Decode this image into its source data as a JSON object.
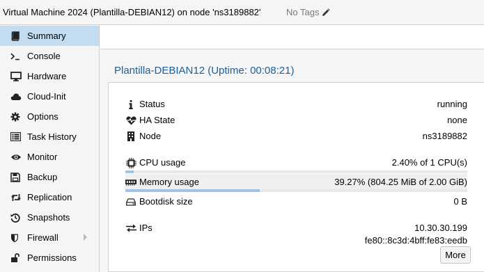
{
  "header": {
    "vm_title": "Virtual Machine 2024 (Plantilla-DEBIAN12) on node 'ns3189882'",
    "tags_label": "No Tags"
  },
  "sidebar": {
    "items": [
      {
        "label": "Summary",
        "icon": "book-icon",
        "active": true
      },
      {
        "label": "Console",
        "icon": "terminal-icon"
      },
      {
        "label": "Hardware",
        "icon": "monitor-icon"
      },
      {
        "label": "Cloud-Init",
        "icon": "cloud-icon"
      },
      {
        "label": "Options",
        "icon": "gear-icon"
      },
      {
        "label": "Task History",
        "icon": "list-icon"
      },
      {
        "label": "Monitor",
        "icon": "eye-icon"
      },
      {
        "label": "Backup",
        "icon": "floppy-icon"
      },
      {
        "label": "Replication",
        "icon": "retweet-icon"
      },
      {
        "label": "Snapshots",
        "icon": "history-icon"
      },
      {
        "label": "Firewall",
        "icon": "shield-icon",
        "has_submenu": true
      },
      {
        "label": "Permissions",
        "icon": "unlock-icon"
      }
    ]
  },
  "summary": {
    "title": "Plantilla-DEBIAN12 (Uptime: 00:08:21)",
    "status": {
      "label": "Status",
      "value": "running"
    },
    "ha_state": {
      "label": "HA State",
      "value": "none"
    },
    "node": {
      "label": "Node",
      "value": "ns3189882"
    },
    "cpu": {
      "label": "CPU usage",
      "value": "2.40% of 1 CPU(s)",
      "fraction": 0.024
    },
    "memory": {
      "label": "Memory usage",
      "value": "39.27% (804.25 MiB of 2.00 GiB)",
      "fraction": 0.3927
    },
    "bootdisk": {
      "label": "Bootdisk size",
      "value": "0 B"
    },
    "ips": {
      "label": "IPs",
      "values": [
        "10.30.30.199",
        "fe80::8c3d:4bff:fe83:eedb"
      ]
    },
    "more_label": "More"
  },
  "colors": {
    "accent_title": "#1e5e96",
    "active_nav": "#c2ddf2",
    "bar_fill": "#9ec3e6"
  }
}
